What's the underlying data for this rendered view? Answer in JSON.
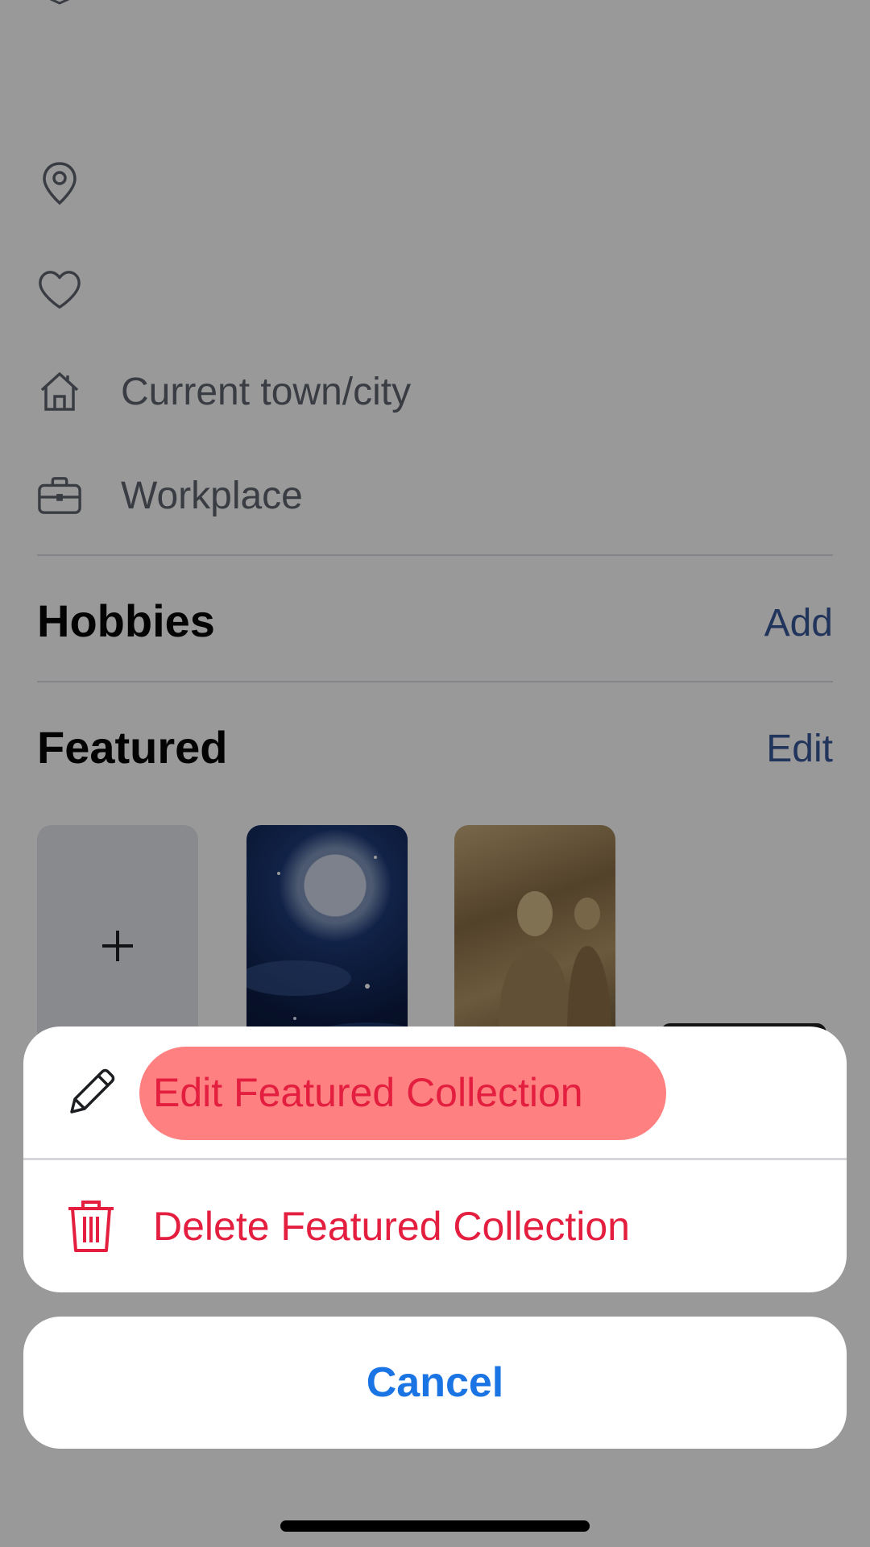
{
  "profile": {
    "current_city_label": "Current town/city",
    "workplace_label": "Workplace"
  },
  "hobbies": {
    "title": "Hobbies",
    "action": "Add"
  },
  "featured": {
    "title": "Featured",
    "action": "Edit",
    "add_tile_symbol": "+"
  },
  "action_sheet": {
    "edit_label": "Edit Featured Collection",
    "delete_label": "Delete Featured Collection",
    "cancel_label": "Cancel"
  },
  "icons": {
    "location": "location-pin-icon",
    "relationship": "heart-icon",
    "city": "home-icon",
    "workplace": "briefcase-icon",
    "edit": "pencil-icon",
    "delete": "trash-icon"
  },
  "colors": {
    "destructive": "#e41e3f",
    "link": "#385898",
    "cancel": "#1b74e4",
    "highlight": "#ff8080"
  }
}
